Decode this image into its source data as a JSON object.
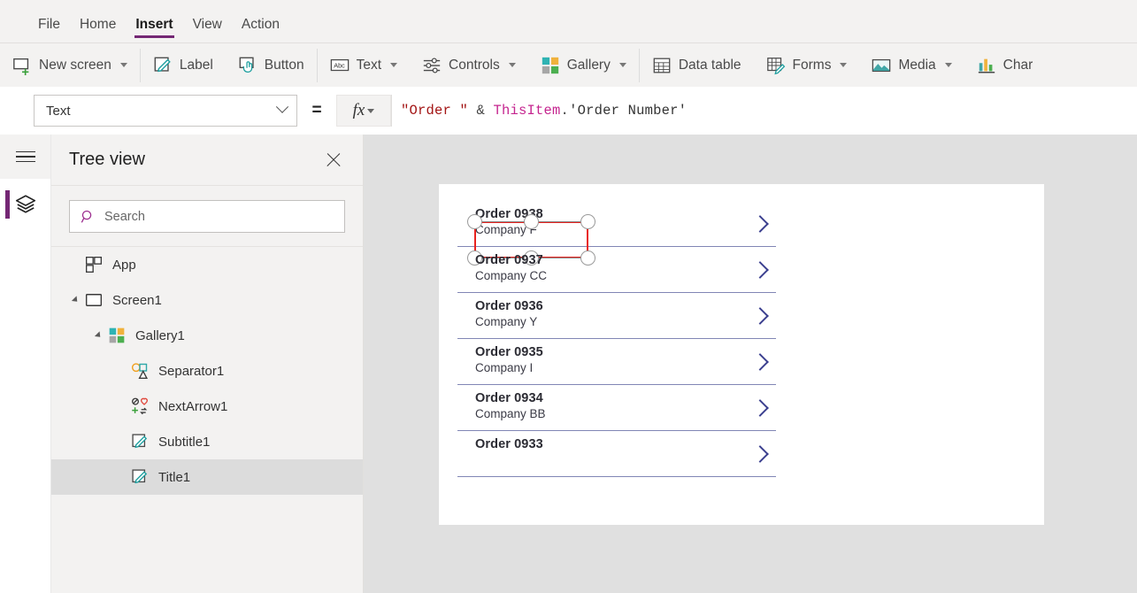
{
  "menu": {
    "tabs": [
      {
        "label": "File",
        "active": false
      },
      {
        "label": "Home",
        "active": false
      },
      {
        "label": "Insert",
        "active": true
      },
      {
        "label": "View",
        "active": false
      },
      {
        "label": "Action",
        "active": false
      }
    ]
  },
  "ribbon": {
    "items": [
      {
        "label": "New screen",
        "icon": "new-screen-icon",
        "caret": true
      },
      {
        "label": "Label",
        "icon": "label-icon",
        "caret": false
      },
      {
        "label": "Button",
        "icon": "button-icon",
        "caret": false
      },
      {
        "label": "Text",
        "icon": "text-abc-icon",
        "caret": true
      },
      {
        "label": "Controls",
        "icon": "controls-icon",
        "caret": true
      },
      {
        "label": "Gallery",
        "icon": "gallery-icon",
        "caret": true
      },
      {
        "label": "Data table",
        "icon": "data-table-icon",
        "caret": false
      },
      {
        "label": "Forms",
        "icon": "forms-icon",
        "caret": true
      },
      {
        "label": "Media",
        "icon": "media-icon",
        "caret": true
      },
      {
        "label": "Char",
        "icon": "charts-icon",
        "caret": false
      }
    ]
  },
  "formula_bar": {
    "property": "Text",
    "equals": "=",
    "fx_label": "fx",
    "formula_tokens": [
      {
        "text": "\"Order \"",
        "kind": "tk-str"
      },
      {
        "text": " & ",
        "kind": "tk-op"
      },
      {
        "text": "ThisItem",
        "kind": "tk-obj"
      },
      {
        "text": ".",
        "kind": "tk-dot"
      },
      {
        "text": "'Order Number'",
        "kind": "tk-fld"
      }
    ],
    "formula_text": "\"Order \" & ThisItem.'Order Number'"
  },
  "rail": {
    "menu_icon": "hamburger-icon",
    "tree_view_icon": "layers-icon",
    "active_color": "#742774"
  },
  "tree_panel": {
    "title": "Tree view",
    "close_icon": "close-icon",
    "search": {
      "placeholder": "Search",
      "value": "",
      "icon": "search-icon"
    },
    "nodes": [
      {
        "label": "App",
        "icon": "app-icon",
        "indent": 0,
        "twisty": "none",
        "selected": false
      },
      {
        "label": "Screen1",
        "icon": "screen-icon",
        "indent": 0,
        "twisty": "expanded",
        "selected": false
      },
      {
        "label": "Gallery1",
        "icon": "gallery-icon",
        "indent": 1,
        "twisty": "expanded",
        "selected": false
      },
      {
        "label": "Separator1",
        "icon": "separator-icon",
        "indent": 2,
        "twisty": "none",
        "selected": false
      },
      {
        "label": "NextArrow1",
        "icon": "nextarrow-icon",
        "indent": 2,
        "twisty": "none",
        "selected": false
      },
      {
        "label": "Subtitle1",
        "icon": "label-icon",
        "indent": 2,
        "twisty": "none",
        "selected": false
      },
      {
        "label": "Title1",
        "icon": "label-icon",
        "indent": 2,
        "twisty": "none",
        "selected": true
      }
    ]
  },
  "canvas": {
    "gallery": {
      "chevron_icon": "chevron-right-icon",
      "chevron_color": "#3b3f8f",
      "separator_color": "#8186b5",
      "selection_color": "#e8231f",
      "rows": [
        {
          "title": "Order 0938",
          "subtitle": "Company F",
          "selected": true
        },
        {
          "title": "Order 0937",
          "subtitle": "Company CC",
          "selected": false
        },
        {
          "title": "Order 0936",
          "subtitle": "Company Y",
          "selected": false
        },
        {
          "title": "Order 0935",
          "subtitle": "Company I",
          "selected": false
        },
        {
          "title": "Order 0934",
          "subtitle": "Company BB",
          "selected": false
        },
        {
          "title": "Order 0933",
          "subtitle": "",
          "selected": false
        }
      ]
    }
  }
}
